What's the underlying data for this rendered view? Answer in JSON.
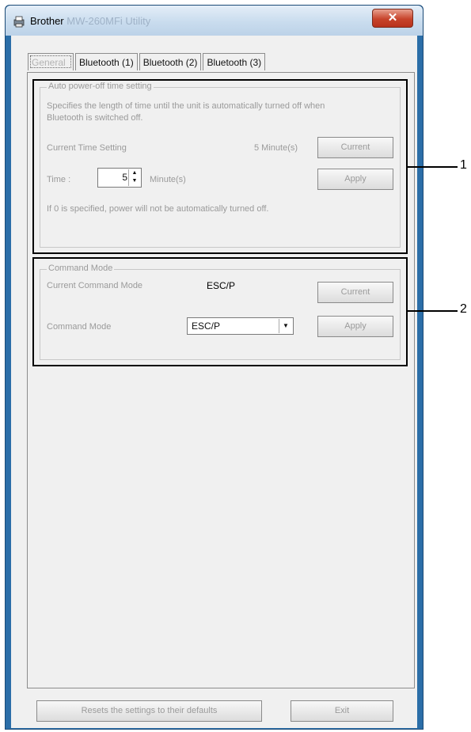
{
  "window": {
    "title_brand": "Brother",
    "title_rest": "MW-260MFi Utility",
    "close_glyph": "✕"
  },
  "tabs": [
    {
      "label": "General"
    },
    {
      "label": "Bluetooth (1)"
    },
    {
      "label": "Bluetooth (2)"
    },
    {
      "label": "Bluetooth (3)"
    }
  ],
  "auto_power_off": {
    "legend": "Auto power-off time setting",
    "description_line1": "Specifies the length of time until the unit is automatically turned off when",
    "description_line2": "Bluetooth is switched off.",
    "current_label": "Current Time Setting",
    "current_value": "5 Minute(s)",
    "current_button": "Current",
    "time_label": "Time :",
    "time_value": "5",
    "time_unit": "Minute(s)",
    "apply_button": "Apply",
    "note": "If 0 is specified, power will not be automatically turned off."
  },
  "command_mode": {
    "legend": "Command Mode",
    "current_label": "Current Command Mode",
    "current_value": "ESC/P",
    "current_button": "Current",
    "mode_label": "Command Mode",
    "mode_selected": "ESC/P",
    "apply_button": "Apply"
  },
  "footer": {
    "reset_button": "Resets the settings to their defaults",
    "exit_button": "Exit"
  },
  "callouts": [
    {
      "number": "1"
    },
    {
      "number": "2"
    }
  ]
}
